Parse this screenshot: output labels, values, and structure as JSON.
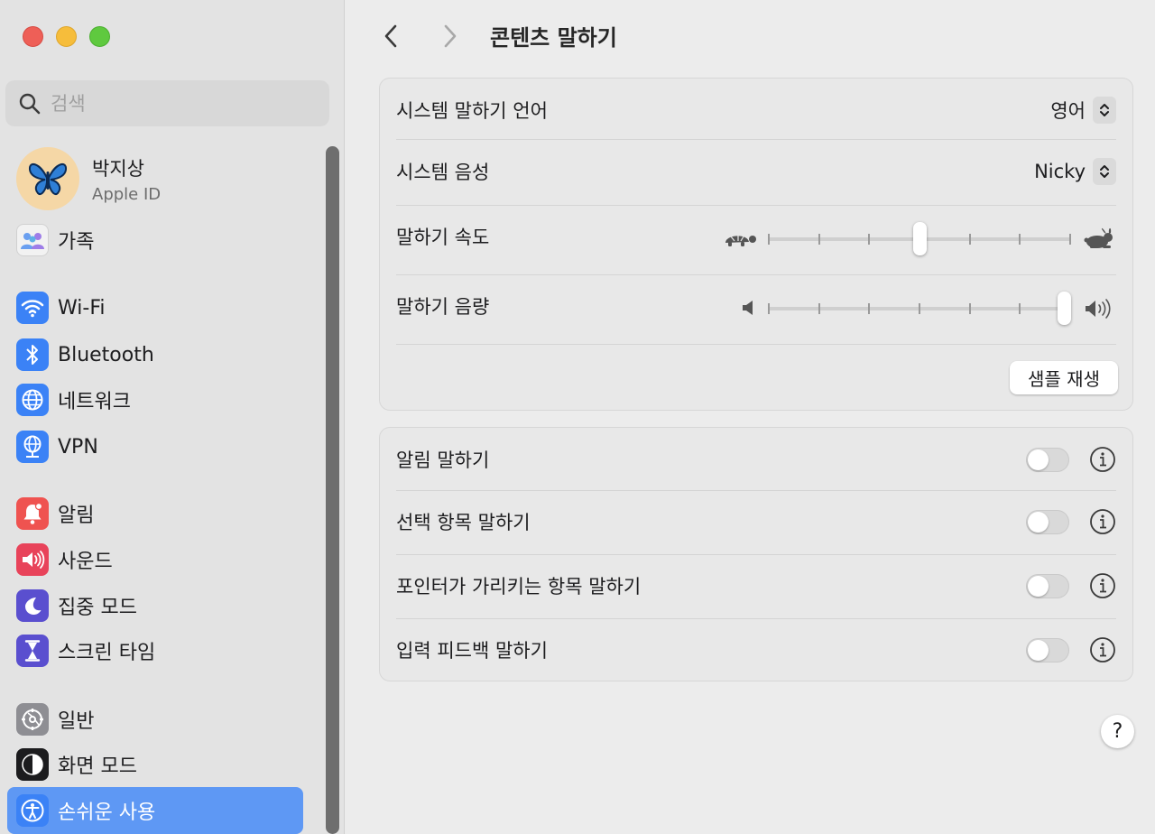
{
  "sidebar": {
    "search_placeholder": "검색",
    "profile": {
      "name": "박지상",
      "sub": "Apple ID"
    },
    "items": [
      {
        "label": "가족",
        "icon": "family-icon"
      },
      {
        "label": "Wi-Fi",
        "icon": "wifi-icon"
      },
      {
        "label": "Bluetooth",
        "icon": "bluetooth-icon"
      },
      {
        "label": "네트워크",
        "icon": "globe-icon"
      },
      {
        "label": "VPN",
        "icon": "vpn-icon"
      },
      {
        "label": "알림",
        "icon": "bell-icon"
      },
      {
        "label": "사운드",
        "icon": "speaker-icon"
      },
      {
        "label": "집중 모드",
        "icon": "moon-icon"
      },
      {
        "label": "스크린 타임",
        "icon": "hourglass-icon"
      },
      {
        "label": "일반",
        "icon": "gear-icon"
      },
      {
        "label": "화면 모드",
        "icon": "appearance-icon"
      },
      {
        "label": "손쉬운 사용",
        "icon": "accessibility-icon",
        "active": true
      }
    ],
    "colors": {
      "active": "#5e98f4",
      "wifi": "#3b82f6",
      "bell": "#ef5350",
      "sound": "#e8435a",
      "focus": "#5a4fcf",
      "screen_time": "#5a4fcf",
      "general": "#8e8e93"
    }
  },
  "header": {
    "title": "콘텐츠 말하기"
  },
  "panel1": {
    "language": {
      "label": "시스템 말하기 언어",
      "value": "영어"
    },
    "voice": {
      "label": "시스템 음성",
      "value": "Nicky"
    },
    "rate": {
      "label": "말하기 속도",
      "value_fraction": 0.5
    },
    "volume": {
      "label": "말하기 음량",
      "value_fraction": 1.0
    },
    "sample_button": "샘플 재생"
  },
  "panel2": {
    "rows": [
      {
        "label": "알림 말하기",
        "on": false
      },
      {
        "label": "선택 항목 말하기",
        "on": false
      },
      {
        "label": "포인터가 가리키는 항목 말하기",
        "on": false
      },
      {
        "label": "입력 피드백 말하기",
        "on": false
      }
    ]
  },
  "help_label": "?"
}
